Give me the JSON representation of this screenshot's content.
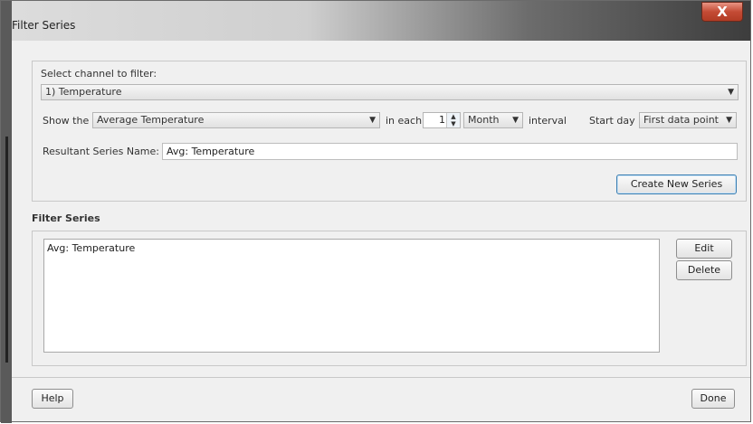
{
  "window": {
    "title": "Filter Series",
    "close_label": "X"
  },
  "channel": {
    "label": "Select channel to filter:",
    "selected": "1) Temperature"
  },
  "show": {
    "prefix": "Show the",
    "function_selected": "Average Temperature",
    "in_each": "in each",
    "count": "1",
    "unit_selected": "Month",
    "interval_label": "interval",
    "start_day_label": "Start day",
    "start_day_selected": "First data point"
  },
  "resultant": {
    "label": "Resultant Series Name:",
    "value": "Avg: Temperature"
  },
  "create_button": "Create New Series",
  "filter_series": {
    "title": "Filter Series",
    "items": [
      "Avg: Temperature"
    ],
    "edit_label": "Edit",
    "delete_label": "Delete"
  },
  "footer": {
    "help_label": "Help",
    "done_label": "Done"
  }
}
